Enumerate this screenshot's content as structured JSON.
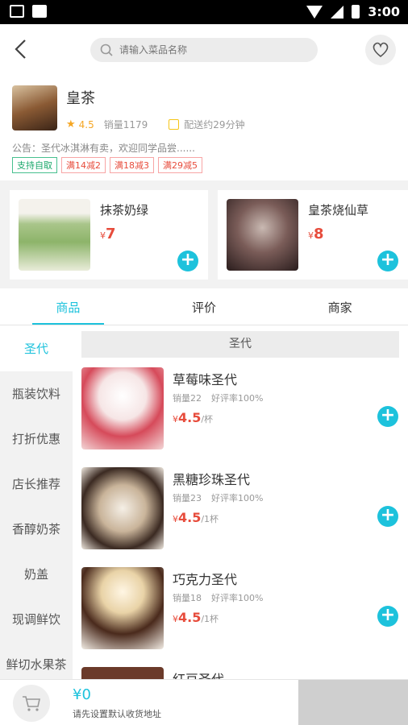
{
  "status_bar": {
    "time": "3:00"
  },
  "search": {
    "placeholder": "请输入菜品名称"
  },
  "shop": {
    "name": "皇茶",
    "rating": "4.5",
    "sales": "销量1179",
    "delivery": "配送约29分钟",
    "notice": "公告：圣代冰淇淋有卖，欢迎同学品尝......",
    "tags": [
      "支持自取",
      "满14减2",
      "满18减3",
      "满29减5"
    ]
  },
  "recommended": [
    {
      "name": "抹茶奶绿",
      "currency": "¥",
      "price": "7"
    },
    {
      "name": "皇茶烧仙草",
      "currency": "¥",
      "price": "8"
    }
  ],
  "tabs": [
    "商品",
    "评价",
    "商家"
  ],
  "categories": [
    "圣代",
    "瓶装饮料",
    "打折优惠",
    "店长推荐",
    "香醇奶茶",
    "奶盖",
    "现调鲜饮",
    "鲜切水果茶"
  ],
  "category_header": "圣代",
  "products": [
    {
      "name": "草莓味圣代",
      "sales": "销量22",
      "rating": "好评率100%",
      "currency": "¥",
      "price": "4.5",
      "unit": "/杯"
    },
    {
      "name": "黑糖珍珠圣代",
      "sales": "销量23",
      "rating": "好评率100%",
      "currency": "¥",
      "price": "4.5",
      "unit": "/1杯"
    },
    {
      "name": "巧克力圣代",
      "sales": "销量18",
      "rating": "好评率100%",
      "currency": "¥",
      "price": "4.5",
      "unit": "/1杯"
    },
    {
      "name": "红豆圣代"
    }
  ],
  "cart": {
    "total": "¥0",
    "hint": "请先设置默认收货地址"
  },
  "colors": {
    "accent": "#1dc2dc",
    "price": "#e74c3c",
    "star": "#f5a623"
  }
}
